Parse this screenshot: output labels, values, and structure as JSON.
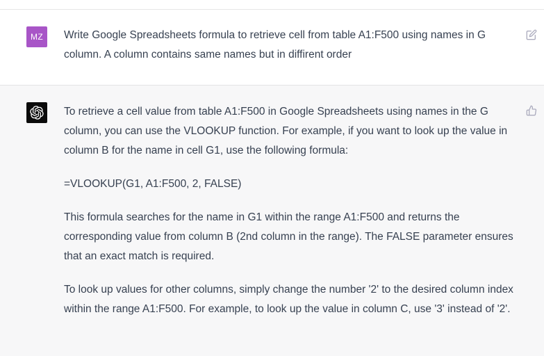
{
  "conversation": {
    "user": {
      "avatar_initials": "MZ",
      "avatar_color": "#a855c7",
      "message": "Write Google Spreadsheets formula to retrieve cell from table A1:F500 using names in G column. A column contains same names but in diffirent order"
    },
    "assistant": {
      "avatar_color": "#0b0b0b",
      "paragraphs": [
        "To retrieve a cell value from table A1:F500 in Google Spreadsheets using names in the G column, you can use the VLOOKUP function. For example, if you want to look up the value in column B for the name in cell G1, use the following formula:",
        "=VLOOKUP(G1, A1:F500, 2, FALSE)",
        "This formula searches for the name in G1 within the range A1:F500 and returns the corresponding value from column B (2nd column in the range). The FALSE parameter ensures that an exact match is required.",
        "To look up values for other columns, simply change the number '2' to the desired column index within the range A1:F500. For example, to look up the value in column C, use '3' instead of '2'."
      ]
    }
  },
  "icons": {
    "edit": "edit-icon",
    "thumbs_up": "thumbs-up-icon",
    "assistant_logo": "openai-logo-icon"
  },
  "colors": {
    "text": "#374151",
    "icon_gray": "#acacbe",
    "assistant_bg": "#f7f7f8"
  }
}
